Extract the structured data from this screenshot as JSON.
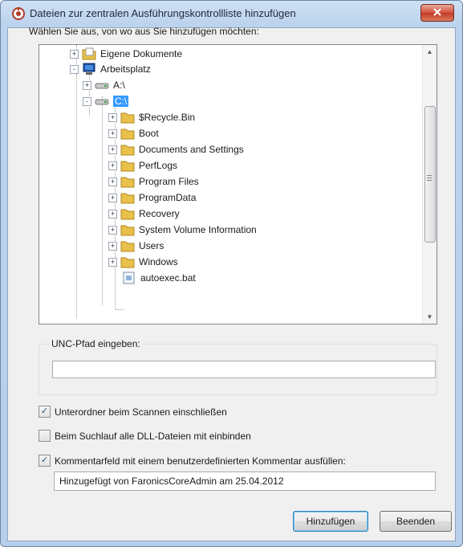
{
  "window": {
    "title": "Dateien zur zentralen Ausführungskontrollliste hinzufügen"
  },
  "prompt": "Wählen Sie aus, von wo aus Sie hinzufügen möchten:",
  "tree": {
    "items": [
      {
        "label": "Eigene Dokumente",
        "icon": "folder-icon",
        "expander": "+"
      },
      {
        "label": "Arbeitsplatz",
        "icon": "computer-icon",
        "expander": "-"
      },
      {
        "label": "A:\\",
        "icon": "drive-icon",
        "expander": "+"
      },
      {
        "label": "C:\\",
        "icon": "drive-icon",
        "expander": "-",
        "selected": true
      },
      {
        "label": "$Recycle.Bin",
        "icon": "folder-icon",
        "expander": "+"
      },
      {
        "label": "Boot",
        "icon": "folder-icon",
        "expander": "+"
      },
      {
        "label": "Documents and Settings",
        "icon": "folder-icon",
        "expander": "+"
      },
      {
        "label": "PerfLogs",
        "icon": "folder-icon",
        "expander": "+"
      },
      {
        "label": "Program Files",
        "icon": "folder-icon",
        "expander": "+"
      },
      {
        "label": "ProgramData",
        "icon": "folder-icon",
        "expander": "+"
      },
      {
        "label": "Recovery",
        "icon": "folder-icon",
        "expander": "+"
      },
      {
        "label": "System Volume Information",
        "icon": "folder-icon",
        "expander": "+"
      },
      {
        "label": "Users",
        "icon": "folder-icon",
        "expander": "+"
      },
      {
        "label": "Windows",
        "icon": "folder-icon",
        "expander": "+"
      },
      {
        "label": "autoexec.bat",
        "icon": "file-icon",
        "expander": ""
      }
    ]
  },
  "unc": {
    "caption": "UNC-Pfad eingeben:",
    "value": ""
  },
  "options": {
    "include_subfolders": {
      "label": "Unterordner beim Scannen einschließen",
      "checked": true
    },
    "include_dll": {
      "label": "Beim Suchlauf alle DLL-Dateien mit einbinden",
      "checked": false
    },
    "fill_comment": {
      "label": "Kommentarfeld mit einem benutzerdefinierten Kommentar ausfüllen:",
      "checked": true
    }
  },
  "comment": {
    "value": "Hinzugefügt von FaronicsCoreAdmin am 25.04.2012"
  },
  "buttons": {
    "add": "Hinzufügen",
    "close": "Beenden"
  },
  "colors": {
    "selection": "#3399ff",
    "folder": "#e8c04a",
    "close_button": "#c84a36"
  }
}
